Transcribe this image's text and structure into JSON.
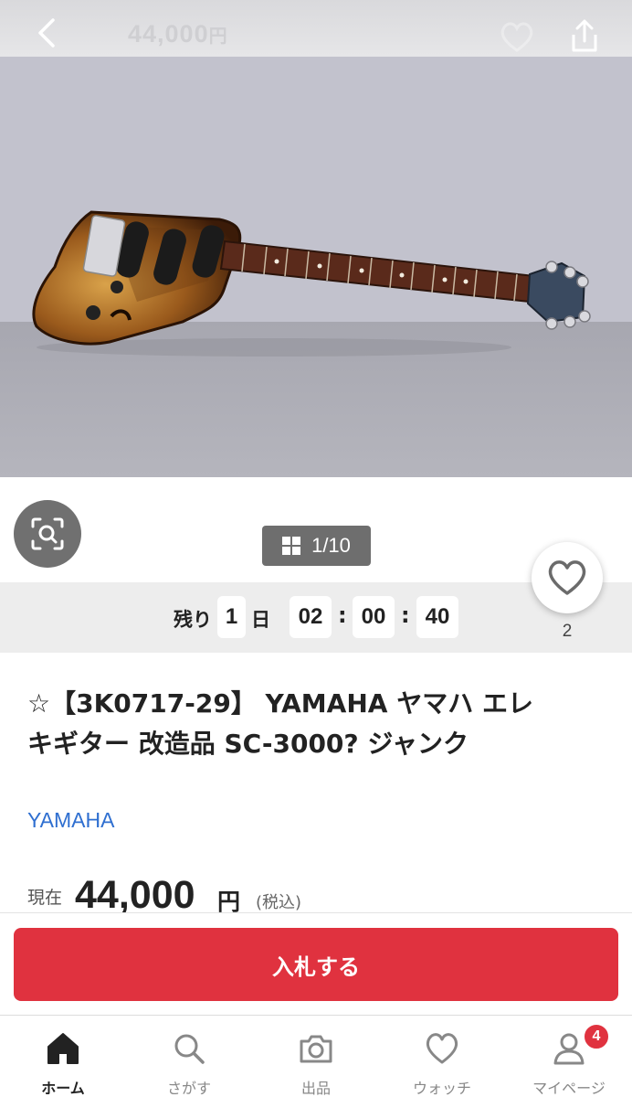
{
  "header": {
    "price": "44,000",
    "price_unit": "円",
    "back_icon": "chevron-left-icon",
    "watch_icon": "heart-outline-icon",
    "share_icon": "share-icon"
  },
  "gallery": {
    "image_alt_icon": "electric-guitar-photo",
    "counter": "1/10",
    "lens_icon": "image-search-icon"
  },
  "timer": {
    "prefix": "残り",
    "days": "1",
    "day_unit": "日",
    "hours": "02",
    "minutes": "00",
    "seconds": "40",
    "separator": ":"
  },
  "watch": {
    "count": "2",
    "icon": "heart-outline-icon"
  },
  "product": {
    "title": "☆【3K0717-29】 YAMAHA ヤマハ エレキギター 改造品 SC-3000? ジャンク",
    "brand": "YAMAHA"
  },
  "price": {
    "label": "現在",
    "value": "44,000",
    "unit": "円",
    "tax": "(税込)"
  },
  "bid": {
    "label": "入札する"
  },
  "tabbar": {
    "items": [
      {
        "label": "ホーム",
        "icon": "home-icon",
        "active": true
      },
      {
        "label": "さがす",
        "icon": "search-icon",
        "active": false
      },
      {
        "label": "出品",
        "icon": "camera-icon",
        "active": false
      },
      {
        "label": "ウォッチ",
        "icon": "heart-icon",
        "active": false
      },
      {
        "label": "マイページ",
        "icon": "user-icon",
        "active": false,
        "badge": "4"
      }
    ]
  },
  "colors": {
    "accent_red": "#e0323f",
    "link_blue": "#2f6fd0",
    "band_gray": "#ededed"
  }
}
